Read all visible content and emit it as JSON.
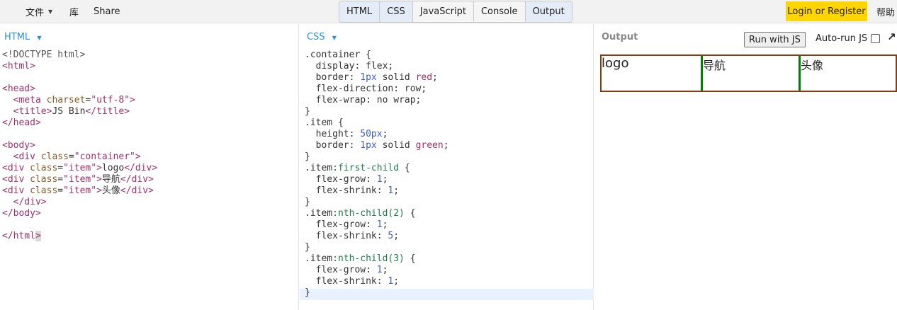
{
  "menu": {
    "file": "文件",
    "library": "库",
    "share": "Share"
  },
  "tabs": [
    "HTML",
    "CSS",
    "JavaScript",
    "Console",
    "Output"
  ],
  "auth": {
    "login": "Login or Register",
    "help": "帮助"
  },
  "html_panel": {
    "label": "HTML"
  },
  "css_panel": {
    "label": "CSS"
  },
  "output_panel": {
    "label": "Output",
    "run_button": "Run with JS",
    "autorun_label": "Auto-run JS",
    "popout_icon": "↗",
    "items": [
      "logo",
      "导航",
      "头像"
    ]
  }
}
